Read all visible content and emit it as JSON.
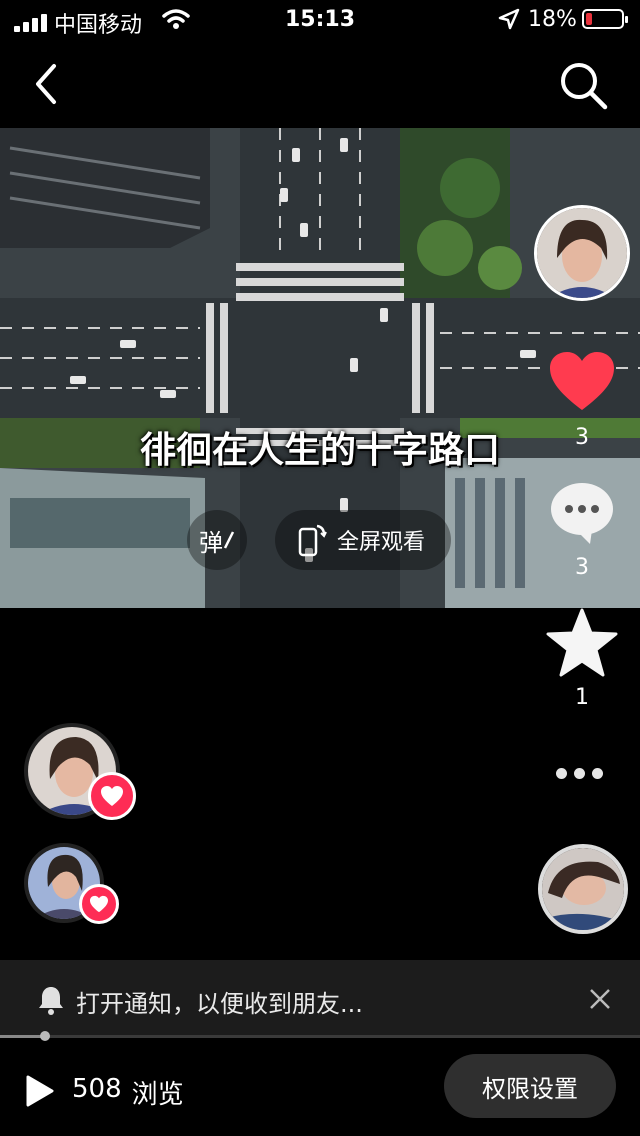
{
  "status_bar": {
    "carrier": "中国移动",
    "time": "15:13",
    "battery_percent": "18%",
    "battery_level": 0.18,
    "icons": [
      "signal-icon",
      "wifi-icon",
      "location-arrow-icon",
      "battery-icon"
    ]
  },
  "header": {
    "back_icon": "chevron-left-icon",
    "search_icon": "search-icon"
  },
  "video": {
    "caption": "徘徊在人生的十字路口",
    "danmu_label": "弹",
    "fullscreen_label": "全屏观看"
  },
  "actions": {
    "likes": "3",
    "comments": "3",
    "favorites": "1"
  },
  "notification": {
    "text": "打开通知，以便收到朋友..."
  },
  "bottom": {
    "view_count": "508",
    "view_label": "浏览",
    "permission_button": "权限设置"
  },
  "progress": {
    "fraction": 0.07
  },
  "colors": {
    "accent_red": "#fe2c55",
    "like_red": "#ff3b4f",
    "background": "#000000"
  }
}
